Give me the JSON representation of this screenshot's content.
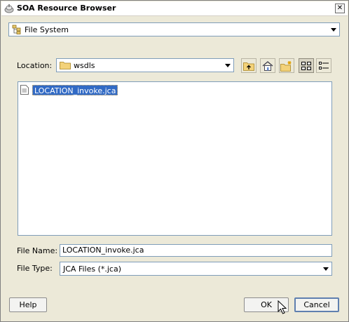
{
  "window": {
    "title": "SOA Resource Browser",
    "close_label": "✕"
  },
  "source_selector": {
    "selected": "File System",
    "icon": "filesystem-icon"
  },
  "location": {
    "label": "Location:",
    "value": "wsdls",
    "icon": "folder-icon"
  },
  "toolbar": {
    "buttons": [
      "up-folder-icon",
      "home-icon",
      "new-folder-icon",
      "list-view-icon",
      "details-view-icon"
    ]
  },
  "file_list": {
    "items": [
      {
        "name": "LOCATION_invoke.jca",
        "selected": true,
        "icon": "document-icon"
      }
    ]
  },
  "file_name": {
    "label": "File Name:",
    "value": "LOCATION_invoke.jca"
  },
  "file_type": {
    "label": "File Type:",
    "value": "JCA Files (*.jca)"
  },
  "buttons": {
    "help": "Help",
    "ok": "OK",
    "cancel": "Cancel"
  },
  "colors": {
    "selection": "#316ac5",
    "window_bg": "#ece9d8",
    "field_border": "#7f9db9"
  }
}
